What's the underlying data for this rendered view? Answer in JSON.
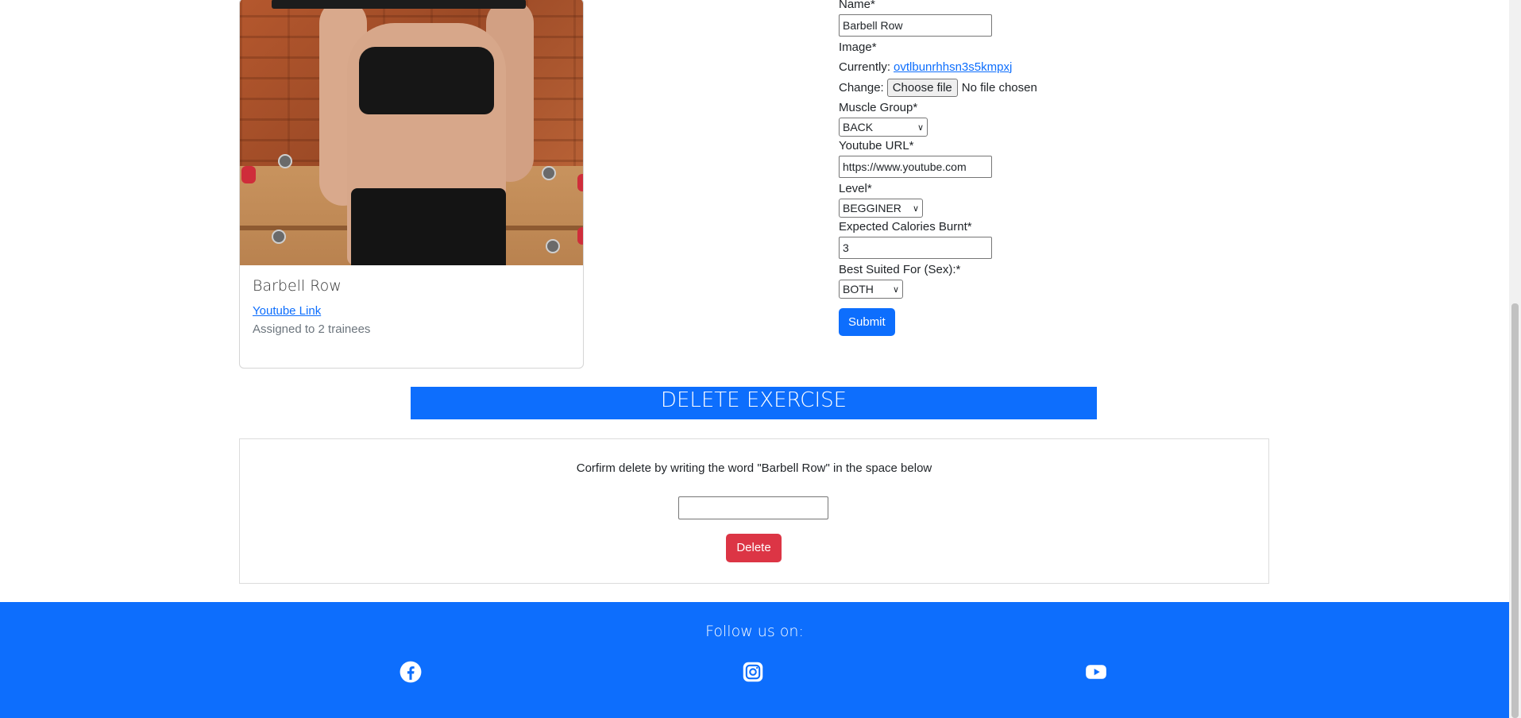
{
  "card": {
    "title": "Barbell Row",
    "youtube_link": "Youtube Link",
    "assigned": "Assigned to 2 trainees"
  },
  "form": {
    "name_label": "Name*",
    "name_value": "Barbell Row",
    "image_label": "Image*",
    "currently_label": "Currently:",
    "currently_file": "ovtlbunrhhsn3s5kmpxj",
    "change_label": "Change:",
    "choose_file": "Choose file",
    "no_file": "No file chosen",
    "muscle_label": "Muscle Group*",
    "muscle_value": "BACK",
    "youtube_label": "Youtube URL*",
    "youtube_value": "https://www.youtube.com",
    "level_label": "Level*",
    "level_value": "BEGGINER",
    "calories_label": "Expected Calories Burnt*",
    "calories_value": "3",
    "sex_label": "Best Suited For (Sex):*",
    "sex_value": "BOTH",
    "submit": "Submit"
  },
  "delete": {
    "banner": "DELETE EXERCISE",
    "confirm_text": "Corfirm delete by writing the word \"Barbell Row\" in the space below",
    "button": "Delete"
  },
  "footer": {
    "follow": "Follow us on:",
    "icons": [
      "facebook-icon",
      "instagram-icon",
      "youtube-icon"
    ]
  },
  "colors": {
    "primary": "#0d6efd",
    "danger": "#dc3545"
  }
}
